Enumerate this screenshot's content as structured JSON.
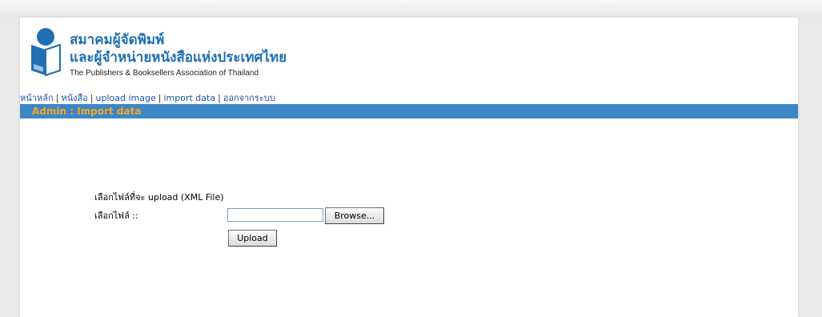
{
  "header": {
    "org_name_th_line1": "สมาคมผู้จัดพิมพ์",
    "org_name_th_line2": "และผู้จำหน่ายหนังสือแห่งประเทศไทย",
    "org_name_en": "The Publishers & Booksellers Association of Thailand"
  },
  "nav": {
    "items": [
      {
        "label": "หน้าหลัก"
      },
      {
        "label": "หนังสือ"
      },
      {
        "label": "upload image"
      },
      {
        "label": "import data"
      },
      {
        "label": "ออกจากระบบ"
      }
    ],
    "separator": "|"
  },
  "section": {
    "title": "Admin : Import data"
  },
  "form": {
    "caption": "เลือกไฟล์ที่จะ upload (XML File)",
    "file_label": "เลือกไฟล์ ::",
    "file_value": "",
    "browse_label": "Browse...",
    "upload_label": "Upload"
  },
  "colors": {
    "brand_blue": "#1f6fb2",
    "section_bar": "#3d86c6",
    "section_title": "#f6a81c",
    "link": "#1a53a8"
  }
}
